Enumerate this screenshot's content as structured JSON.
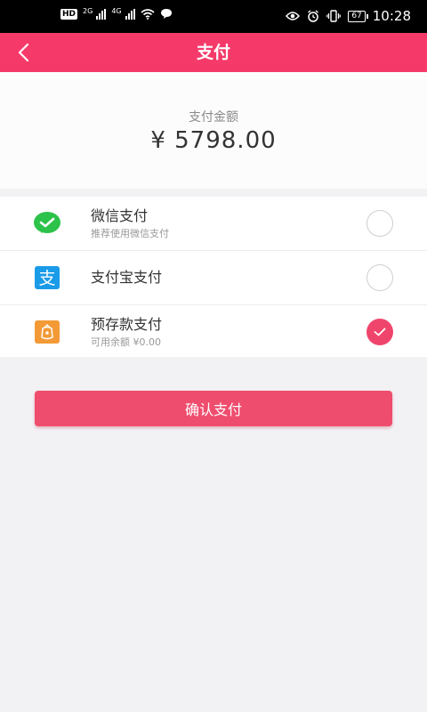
{
  "status_bar": {
    "hd_label": "HD",
    "sim1_label": "2G",
    "sim2_label": "4G",
    "battery": "67",
    "time": "10:28"
  },
  "nav": {
    "title": "支付"
  },
  "amount": {
    "label": "支付金额",
    "value": "¥ 5798.00"
  },
  "payment_methods": [
    {
      "title": "微信支付",
      "subtitle": "推荐使用微信支付",
      "icon": "wechat-pay-icon",
      "selected": false
    },
    {
      "title": "支付宝支付",
      "subtitle": "",
      "icon": "alipay-icon",
      "selected": false
    },
    {
      "title": "预存款支付",
      "subtitle": "可用余额 ¥0.00",
      "icon": "wallet-icon",
      "selected": true
    }
  ],
  "confirm_label": "确认支付",
  "colors": {
    "brand": "#f53a6a",
    "button": "#ef4d6e",
    "wechat": "#2dc24a",
    "alipay": "#1a9be8",
    "wallet": "#f39a36"
  }
}
